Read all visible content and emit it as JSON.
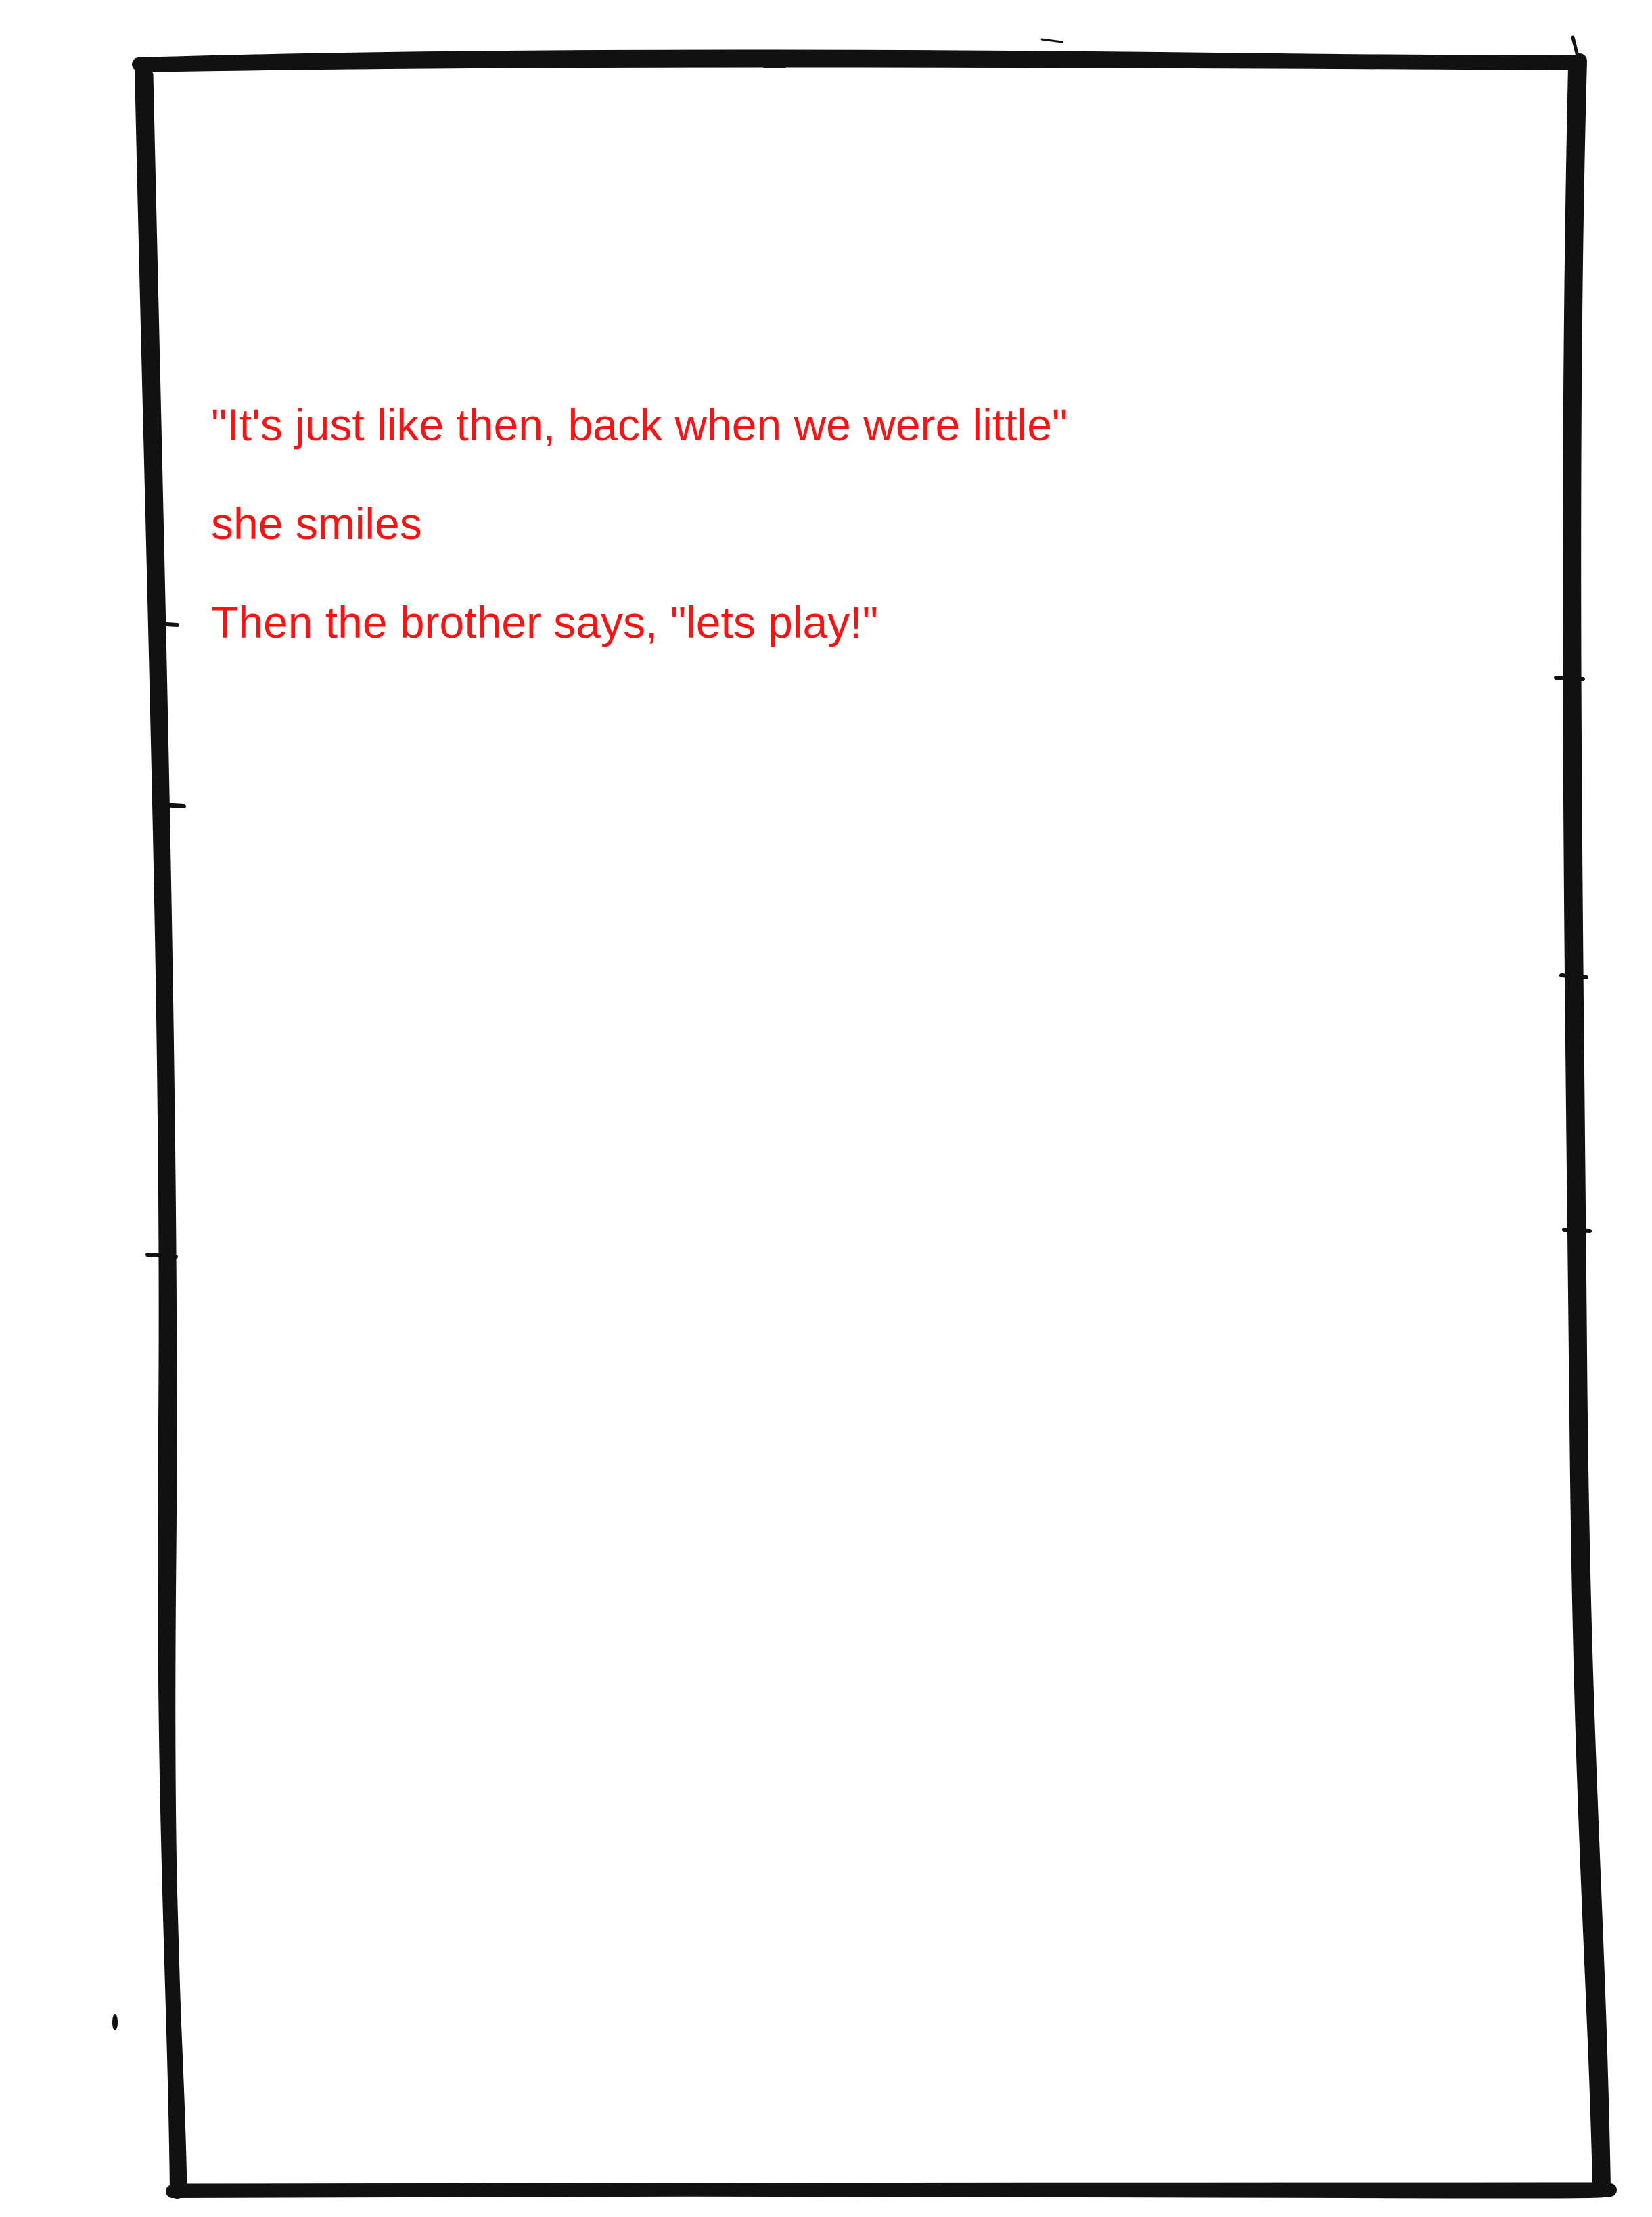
{
  "page": {
    "background_color": "#ffffff",
    "border_color": "#111111",
    "text_color": "#ff1111"
  },
  "caption": {
    "lines": [
      "\"It's just like then, back when we were little\"",
      "she smiles",
      "Then the brother says, \"lets play!\""
    ]
  }
}
